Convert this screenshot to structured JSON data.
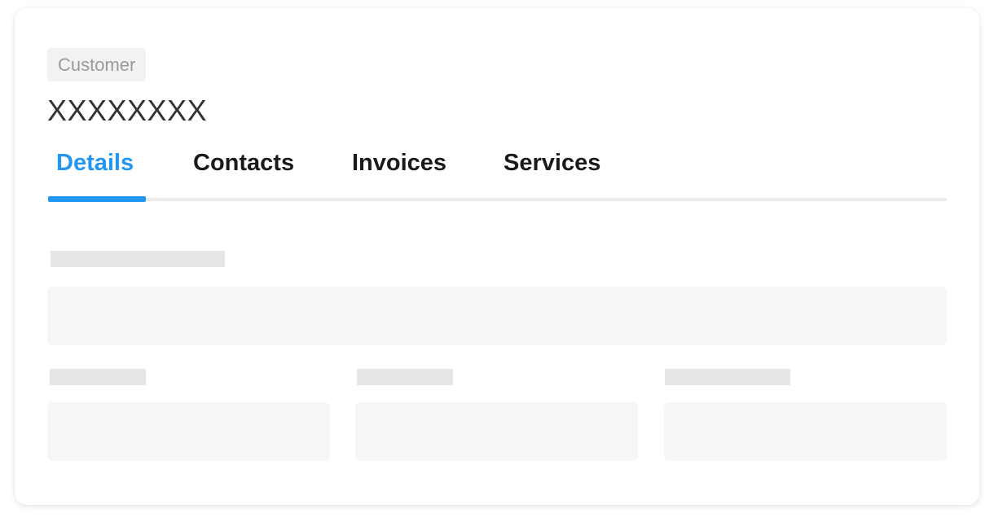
{
  "header": {
    "badge": "Customer",
    "title": "XXXXXXXX"
  },
  "tabs": [
    {
      "label": "Details",
      "active": true
    },
    {
      "label": "Contacts",
      "active": false
    },
    {
      "label": "Invoices",
      "active": false
    },
    {
      "label": "Services",
      "active": false
    }
  ],
  "colors": {
    "accent": "#2196f3",
    "skeleton_label": "#e6e6e6",
    "skeleton_field": "#f6f6f6"
  }
}
